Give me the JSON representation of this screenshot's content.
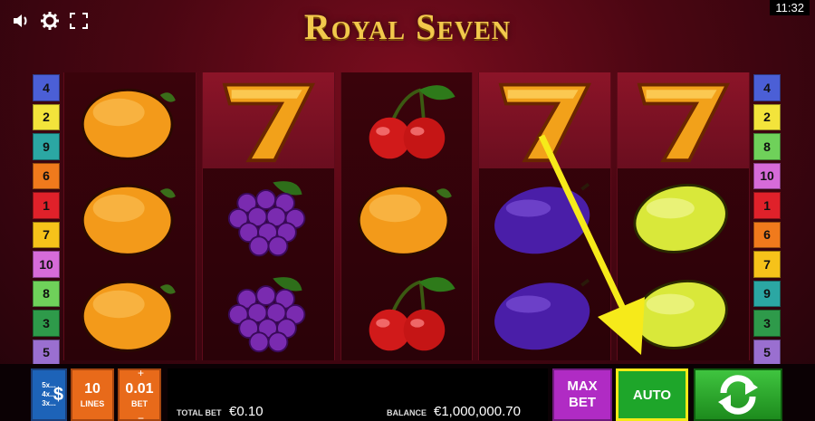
{
  "header": {
    "title": "Royal Seven",
    "clock": "11:32",
    "icons": [
      "sound-icon",
      "gear-icon",
      "fullscreen-icon"
    ]
  },
  "paylines": {
    "left": [
      {
        "label": "4",
        "color": "#4b5fd6"
      },
      {
        "label": "2",
        "color": "#f3e43b"
      },
      {
        "label": "9",
        "color": "#2ba7a3"
      },
      {
        "label": "6",
        "color": "#f07a1c"
      },
      {
        "label": "1",
        "color": "#e0212a"
      },
      {
        "label": "7",
        "color": "#f6c21a"
      },
      {
        "label": "10",
        "color": "#d66bd9"
      },
      {
        "label": "8",
        "color": "#6fd15a"
      },
      {
        "label": "3",
        "color": "#2e9a4a"
      },
      {
        "label": "5",
        "color": "#9a6fd0"
      }
    ],
    "right": [
      {
        "label": "4",
        "color": "#4b5fd6"
      },
      {
        "label": "2",
        "color": "#f3e43b"
      },
      {
        "label": "8",
        "color": "#6fd15a"
      },
      {
        "label": "10",
        "color": "#d66bd9"
      },
      {
        "label": "1",
        "color": "#e0212a"
      },
      {
        "label": "6",
        "color": "#f07a1c"
      },
      {
        "label": "7",
        "color": "#f6c21a"
      },
      {
        "label": "9",
        "color": "#2ba7a3"
      },
      {
        "label": "3",
        "color": "#2e9a4a"
      },
      {
        "label": "5",
        "color": "#9a6fd0"
      }
    ]
  },
  "reels": [
    [
      "orange",
      "orange",
      "orange"
    ],
    [
      "seven",
      "grapes",
      "grapes"
    ],
    [
      "cherries",
      "orange",
      "cherries"
    ],
    [
      "seven",
      "plum",
      "plum"
    ],
    [
      "seven",
      "lemon",
      "lemon"
    ]
  ],
  "controls": {
    "coin_rows": [
      "5x...",
      "4x...",
      "3x..."
    ],
    "coin_symbol": "$",
    "lines_value": "10",
    "lines_label": "LINES",
    "bet_value": "0.01",
    "bet_label": "BET",
    "bet_plus": "+",
    "bet_minus": "−",
    "total_bet_label": "TOTAL BET",
    "total_bet_value": "€0.10",
    "balance_label": "BALANCE",
    "balance_value": "€1,000,000.70",
    "max_bet_label_1": "MAX",
    "max_bet_label_2": "BET",
    "auto_label": "AUTO"
  },
  "colors": {
    "accent_gold": "#f2c94c",
    "highlight_yellow": "#f4ea17",
    "auto_green": "#1ea62a",
    "max_purple": "#b02bc4",
    "lines_orange": "#e86a1a"
  }
}
